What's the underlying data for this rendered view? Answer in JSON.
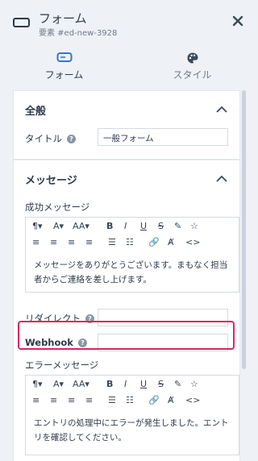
{
  "header": {
    "title": "フォーム",
    "subtitle": "要素 #ed-new-3928"
  },
  "tabs": [
    {
      "label": "フォーム",
      "icon": "form-icon",
      "active": true
    },
    {
      "label": "スタイル",
      "icon": "palette-icon",
      "active": false
    }
  ],
  "general": {
    "title": "全般",
    "title_label": "タイトル",
    "title_value": "一般フォーム"
  },
  "messages": {
    "title": "メッセージ",
    "success_label": "成功メッセージ",
    "success_text": "メッセージをありがとうございます。まもなく担当者からご連絡を差し上げます。",
    "redirect_label": "リダイレクト",
    "redirect_value": "",
    "webhook_label": "Webhook",
    "webhook_value": "",
    "error_label": "エラーメッセージ",
    "error_text": "エントリの処理中にエラーが発生しました。エントリを確認してください。"
  },
  "toolbar": {
    "row1": [
      "¶▾",
      "A▾",
      "AA▾",
      "B",
      "I",
      "U",
      "S",
      "✎",
      "☆"
    ],
    "row2": [
      "≡",
      "≡",
      "≡",
      "≡",
      "☰",
      "☷",
      "🔗",
      "Ⱥ",
      "<>"
    ]
  },
  "colors": {
    "highlight": "#e0245e",
    "accent": "#2e3a4a"
  }
}
